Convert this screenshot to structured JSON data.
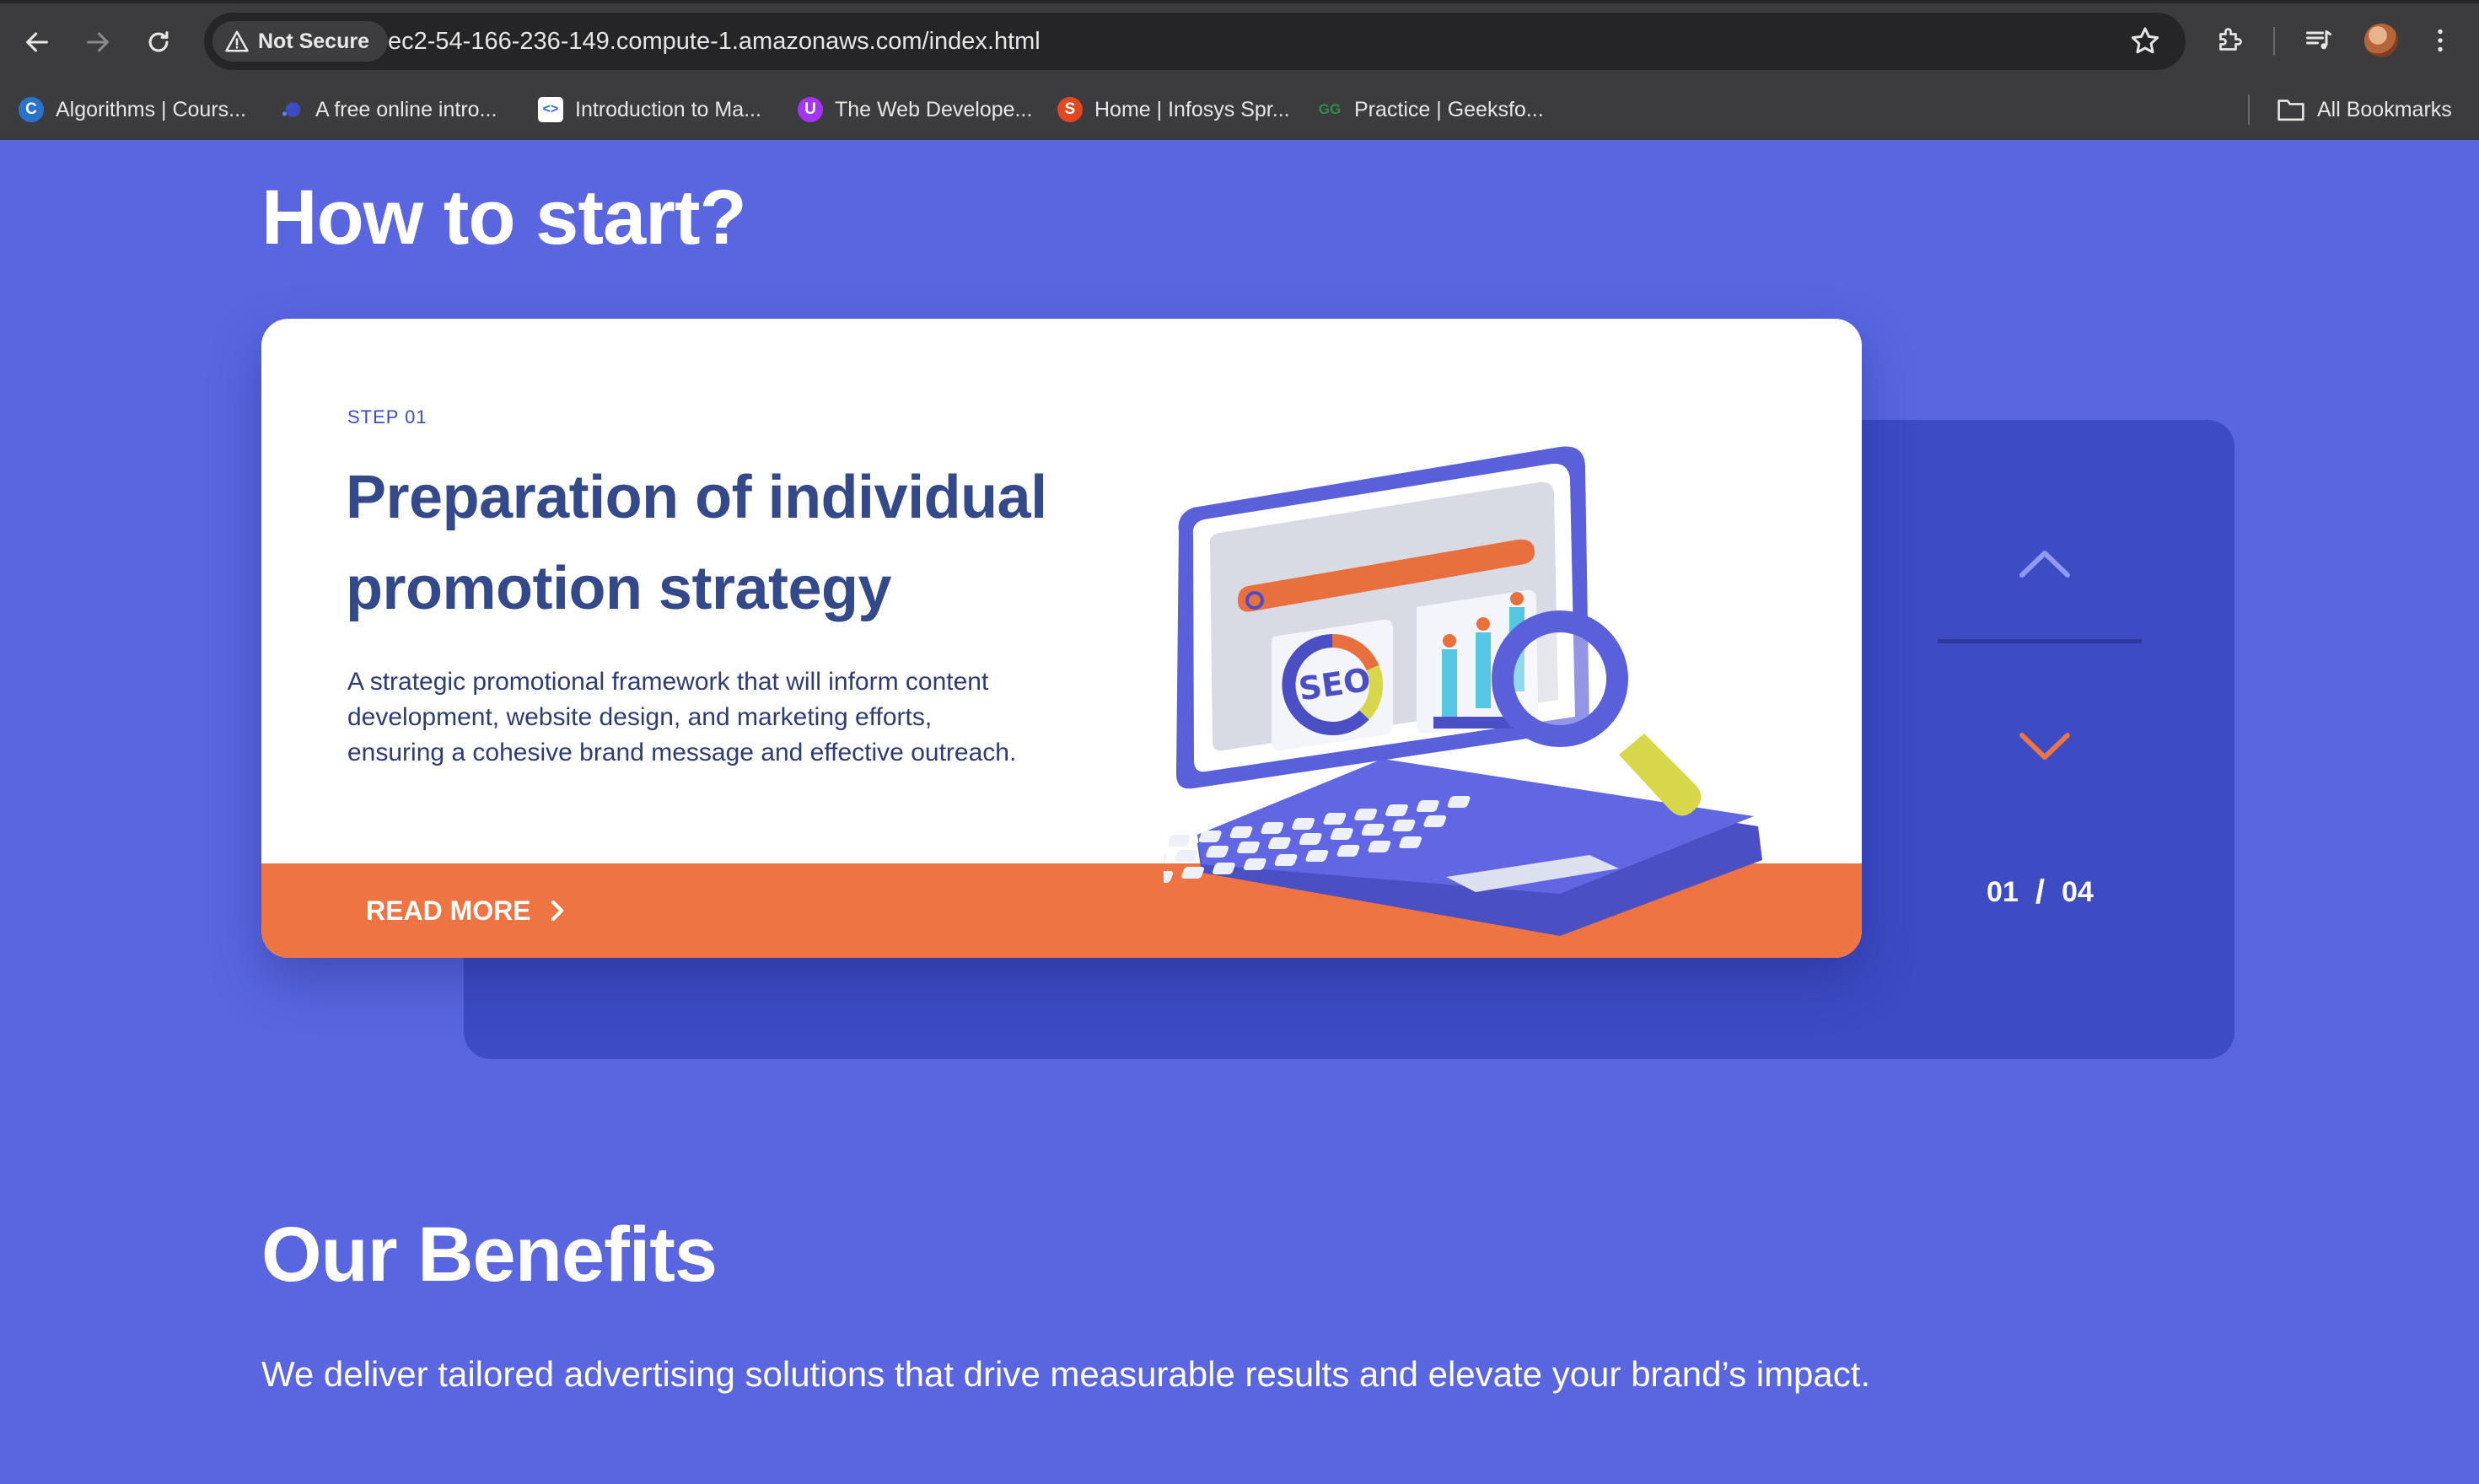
{
  "browser": {
    "not_secure_label": "Not Secure",
    "url": "ec2-54-166-236-149.compute-1.amazonaws.com/index.html",
    "bookmarks": [
      {
        "label": "Algorithms | Cours...",
        "icon": "coursera-icon",
        "color": "#2A73CC",
        "glyph": "C"
      },
      {
        "label": "A free online intro...",
        "icon": "dot-icon",
        "color": "#3D4BC4",
        "glyph": ""
      },
      {
        "label": "Introduction to Ma...",
        "icon": "code-icon",
        "color": "#FFFFFF",
        "glyph": "<>"
      },
      {
        "label": "The Web Develope...",
        "icon": "udemy-icon",
        "color": "#A435F0",
        "glyph": "U"
      },
      {
        "label": "Home | Infosys Spr...",
        "icon": "springboard-icon",
        "color": "#E2481F",
        "glyph": "S"
      },
      {
        "label": "Practice | Geeksfo...",
        "icon": "geeksforgeeks-icon",
        "color": "#2F8D46",
        "glyph": "GG"
      }
    ],
    "all_bookmarks_label": "All Bookmarks"
  },
  "how_to_start": {
    "heading": "How to start?",
    "card": {
      "step_label": "STEP 01",
      "title": "Preparation of individual promotion strategy",
      "description": "A strategic promotional framework that will inform content development, website design, and marketing efforts, ensuring a cohesive brand message and effective outreach.",
      "read_more_label": "READ MORE"
    },
    "counter": {
      "current": "01",
      "separator": "/",
      "total": "04"
    }
  },
  "benefits": {
    "heading": "Our Benefits",
    "description": "We deliver tailored advertising solutions that drive measurable results and elevate your brand’s impact."
  },
  "colors": {
    "page_bg": "#5966E0",
    "panel_bg": "#3D4BC4",
    "accent_orange": "#EE7443",
    "title_navy": "#33498A"
  }
}
